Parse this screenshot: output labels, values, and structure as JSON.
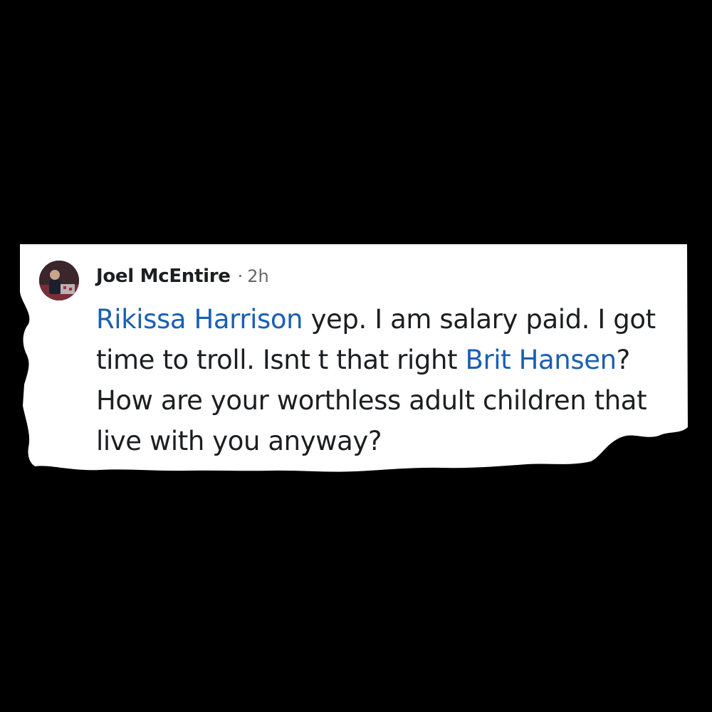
{
  "comment": {
    "author": "Joel McEntire",
    "separator": "·",
    "timestamp": "2h",
    "avatar_icon": "profile-photo-icon",
    "body": [
      {
        "type": "mention",
        "text": "Rikissa Harrison"
      },
      {
        "type": "text",
        "text": " yep. I am salary paid. I got time to troll. Isnt t that right "
      },
      {
        "type": "mention",
        "text": "Brit Hansen"
      },
      {
        "type": "text",
        "text": "? How are your worthless adult children that live with you anyway?"
      }
    ]
  },
  "colors": {
    "background": "#000000",
    "card": "#ffffff",
    "mention": "#1a5fb4",
    "text": "#1c1e21",
    "meta": "#65676b"
  }
}
